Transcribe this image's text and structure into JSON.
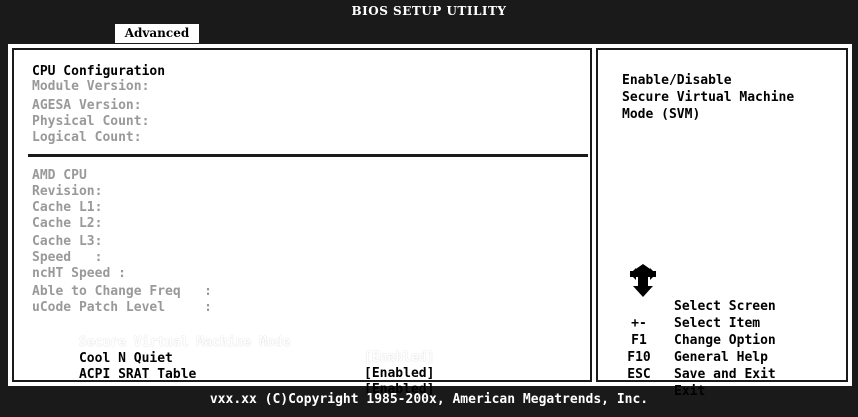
{
  "header": {
    "title": "BIOS SETUP UTILITY",
    "active_tab": "Advanced"
  },
  "left_panel": {
    "section1": [
      "CPU Configuration",
      "Module Version:",
      "AGESA Version:",
      "Physical Count:",
      "Logical Count:"
    ],
    "section2": [
      "AMD CPU",
      "Revision:",
      "Cache L1:",
      "Cache L2:",
      "Cache L3:",
      "Speed   :",
      "ncHT Speed :",
      "Able to Change Freq   :",
      "uCode Patch Level     :"
    ],
    "settings": [
      {
        "label": "Secure Virtual Machine Mode",
        "value": "[Enabled]"
      },
      {
        "label": "Cool N Quiet",
        "value": "[Enabled]"
      },
      {
        "label": "ACPI SRAT Table",
        "value": "[Enabled]"
      }
    ]
  },
  "right_panel": {
    "help_text": "Enable/Disable\nSecure Virtual Machine\nMode (SVM)",
    "keys": [
      {
        "key": "",
        "desc": "Select Screen"
      },
      {
        "key": "",
        "desc": "Select Item"
      },
      {
        "key": "+-",
        "desc": "Change Option"
      },
      {
        "key": "F1",
        "desc": "General Help"
      },
      {
        "key": "F10",
        "desc": "Save and Exit"
      },
      {
        "key": "ESC",
        "desc": "Exit"
      }
    ]
  },
  "footer": {
    "copyright": "vxx.xx (C)Copyright 1985-200x, American Megatrends, Inc."
  }
}
